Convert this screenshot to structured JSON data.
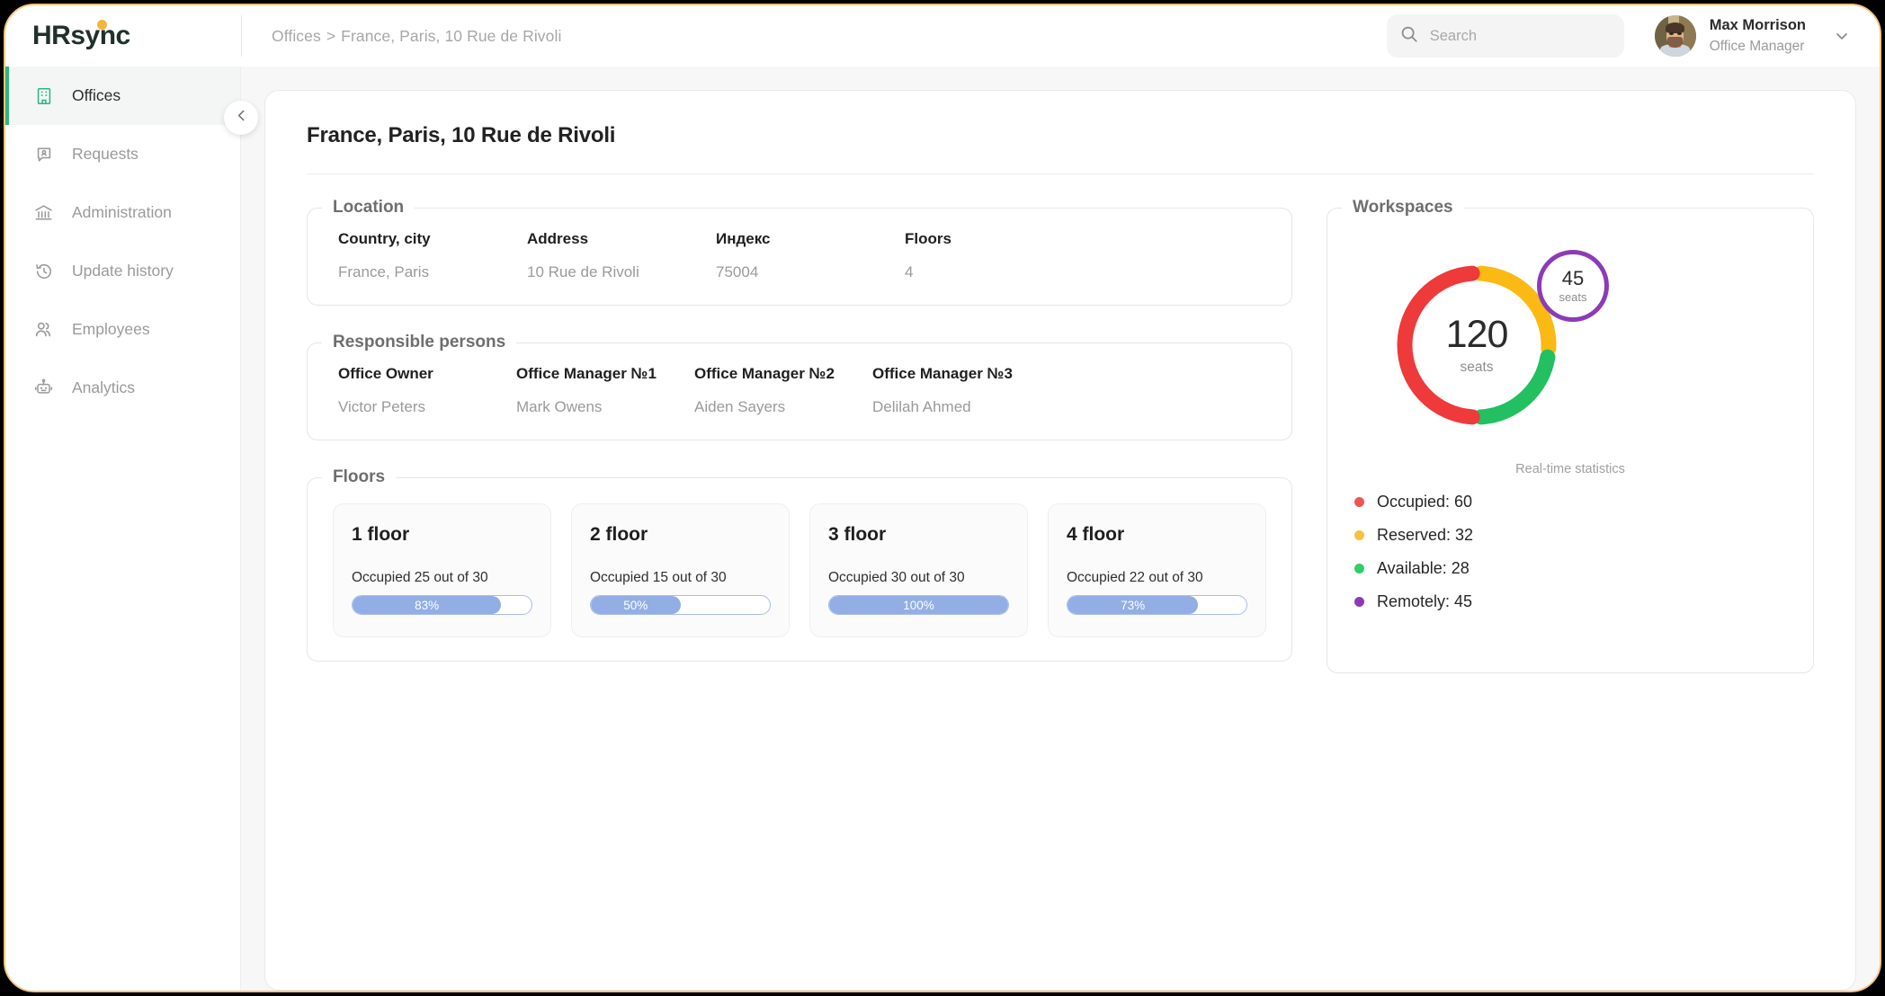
{
  "brand": {
    "name": "HRsync",
    "accent": "#2fb482",
    "frame_color": "#f3c77b"
  },
  "topbar": {
    "breadcrumb": {
      "root": "Offices",
      "separator": ">",
      "current": "France, Paris, 10 Rue de Rivoli"
    },
    "search": {
      "placeholder": "Search",
      "value": ""
    },
    "profile": {
      "name": "Max Morrison",
      "role": "Office Manager"
    }
  },
  "sidebar": {
    "items": [
      {
        "label": "Offices",
        "icon": "building-icon",
        "active": true
      },
      {
        "label": "Requests",
        "icon": "request-badge-icon",
        "active": false
      },
      {
        "label": "Administration",
        "icon": "bank-icon",
        "active": false
      },
      {
        "label": "Update history",
        "icon": "history-clock-icon",
        "active": false
      },
      {
        "label": "Employees",
        "icon": "people-icon",
        "active": false
      },
      {
        "label": "Analytics",
        "icon": "robot-icon",
        "active": false
      }
    ]
  },
  "page": {
    "title": "France, Paris, 10 Rue de Rivoli"
  },
  "location": {
    "legend": "Location",
    "fields": [
      {
        "label": "Country, city",
        "value": "France, Paris"
      },
      {
        "label": "Address",
        "value": "10 Rue de Rivoli"
      },
      {
        "label": "Индекс",
        "value": "75004"
      },
      {
        "label": "Floors",
        "value": "4"
      }
    ]
  },
  "responsible": {
    "legend": "Responsible persons",
    "fields": [
      {
        "label": "Office Owner",
        "value": "Victor Peters"
      },
      {
        "label": "Office Manager №1",
        "value": "Mark Owens"
      },
      {
        "label": "Office Manager №2",
        "value": "Aiden Sayers"
      },
      {
        "label": "Office Manager №3",
        "value": "Delilah Ahmed"
      }
    ]
  },
  "floors": {
    "legend": "Floors",
    "items": [
      {
        "title": "1 floor",
        "subtitle": "Occupied 25 out of 30",
        "percent_label": "83%",
        "percent": 83
      },
      {
        "title": "2 floor",
        "subtitle": "Occupied 15 out of 30",
        "percent_label": "50%",
        "percent": 50
      },
      {
        "title": "3 floor",
        "subtitle": "Occupied 30 out of 30",
        "percent_label": "100%",
        "percent": 100
      },
      {
        "title": "4 floor",
        "subtitle": "Occupied 22 out of 30",
        "percent_label": "73%",
        "percent": 73
      }
    ]
  },
  "workspaces": {
    "legend": "Workspaces",
    "caption": "Real-time statistics",
    "total": "120",
    "total_unit": "seats",
    "remote_total": "45",
    "remote_unit": "seats"
  },
  "chart_data": {
    "type": "pie",
    "title": "Workspaces",
    "subtitle": "Real-time statistics",
    "center_value": 120,
    "center_label": "seats",
    "categories": [
      "Occupied",
      "Reserved",
      "Available"
    ],
    "values": [
      60,
      32,
      28
    ],
    "colors": [
      "#ee3a3a",
      "#fbb913",
      "#22c060"
    ],
    "legend": [
      {
        "label": "Occupied: 60",
        "name": "Occupied",
        "value": 60,
        "color": "#f05555"
      },
      {
        "label": "Reserved: 32",
        "name": "Reserved",
        "value": 32,
        "color": "#f7c242"
      },
      {
        "label": "Available: 28",
        "name": "Available",
        "value": 28,
        "color": "#2ecf6b"
      },
      {
        "label": "Remotely: 45",
        "name": "Remotely",
        "value": 45,
        "color": "#8b3bb8"
      }
    ],
    "secondary_ring": {
      "name": "Remotely",
      "value": 45,
      "label": "45",
      "unit": "seats",
      "color": "#8b3bb8"
    },
    "legend_position": "below"
  }
}
